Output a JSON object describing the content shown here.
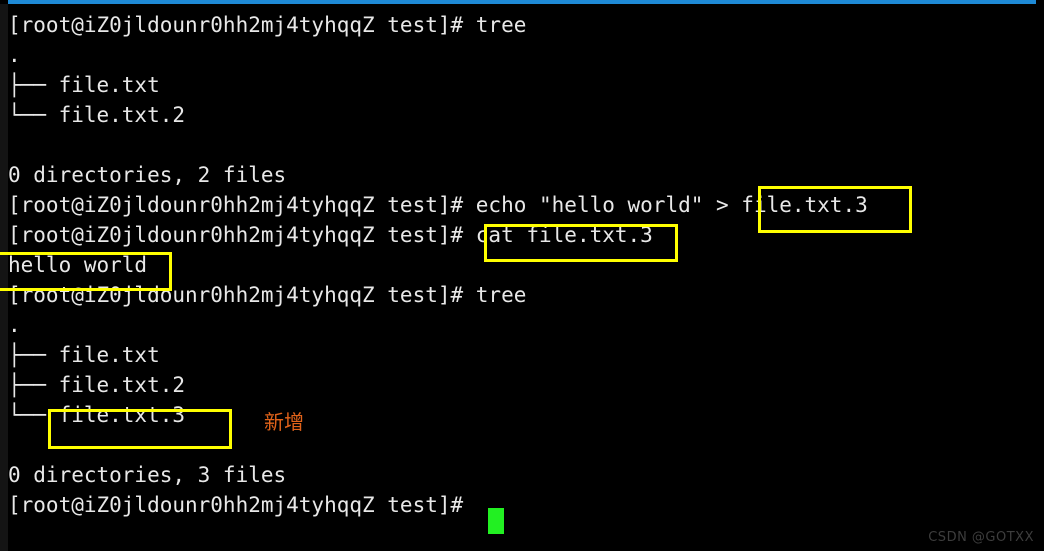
{
  "terminal": {
    "prompt": "[root@iZ0jldounr0hh2mj4tyhqqZ test]# ",
    "lines": [
      {
        "id": "l0",
        "text": "[root@iZ0jldounr0hh2mj4tyhqqZ test]# tree"
      },
      {
        "id": "l1",
        "text": "."
      },
      {
        "id": "l2",
        "text": "├── file.txt"
      },
      {
        "id": "l3",
        "text": "└── file.txt.2"
      },
      {
        "id": "l4",
        "text": ""
      },
      {
        "id": "l5",
        "text": "0 directories, 2 files"
      },
      {
        "id": "l6",
        "text": "[root@iZ0jldounr0hh2mj4tyhqqZ test]# echo \"hello world\" > file.txt.3"
      },
      {
        "id": "l7",
        "text": "[root@iZ0jldounr0hh2mj4tyhqqZ test]# cat file.txt.3"
      },
      {
        "id": "l8",
        "text": "hello world"
      },
      {
        "id": "l9",
        "text": "[root@iZ0jldounr0hh2mj4tyhqqZ test]# tree"
      },
      {
        "id": "l10",
        "text": "."
      },
      {
        "id": "l11",
        "text": "├── file.txt"
      },
      {
        "id": "l12",
        "text": "├── file.txt.2"
      },
      {
        "id": "l13",
        "text": "└── file.txt.3"
      },
      {
        "id": "l14",
        "text": ""
      },
      {
        "id": "l15",
        "text": "0 directories, 3 files"
      },
      {
        "id": "l16",
        "text": "[root@iZ0jldounr0hh2mj4tyhqqZ test]# "
      }
    ],
    "commands": {
      "tree_1": "tree",
      "echo_redirect": "echo \"hello world\" > file.txt.3",
      "cat": "cat file.txt.3",
      "tree_2": "tree"
    },
    "output": {
      "tree_1_summary": "0 directories, 2 files",
      "tree_2_summary": "0 directories, 3 files",
      "cat_result": "hello world",
      "files_before": [
        "file.txt",
        "file.txt.2"
      ],
      "files_after": [
        "file.txt",
        "file.txt.2",
        "file.txt.3"
      ]
    }
  },
  "annotations": {
    "new_file_label": "新增",
    "highlight_color": "#ffff00",
    "annotation_color": "#e2631a",
    "highlights": [
      {
        "name": "highlight-echo-target",
        "label": "file.txt.3"
      },
      {
        "name": "highlight-cat-command",
        "label": "cat file.txt.3"
      },
      {
        "name": "highlight-cat-output",
        "label": "hello world"
      },
      {
        "name": "highlight-tree-new-file",
        "label": "file.txt.3"
      }
    ]
  },
  "watermark": {
    "text": "CSDN @GOTXX"
  },
  "colors": {
    "background": "#000000",
    "foreground": "#e8e8e8",
    "top_bar": "#1e8ad6",
    "cursor": "#22f022"
  }
}
